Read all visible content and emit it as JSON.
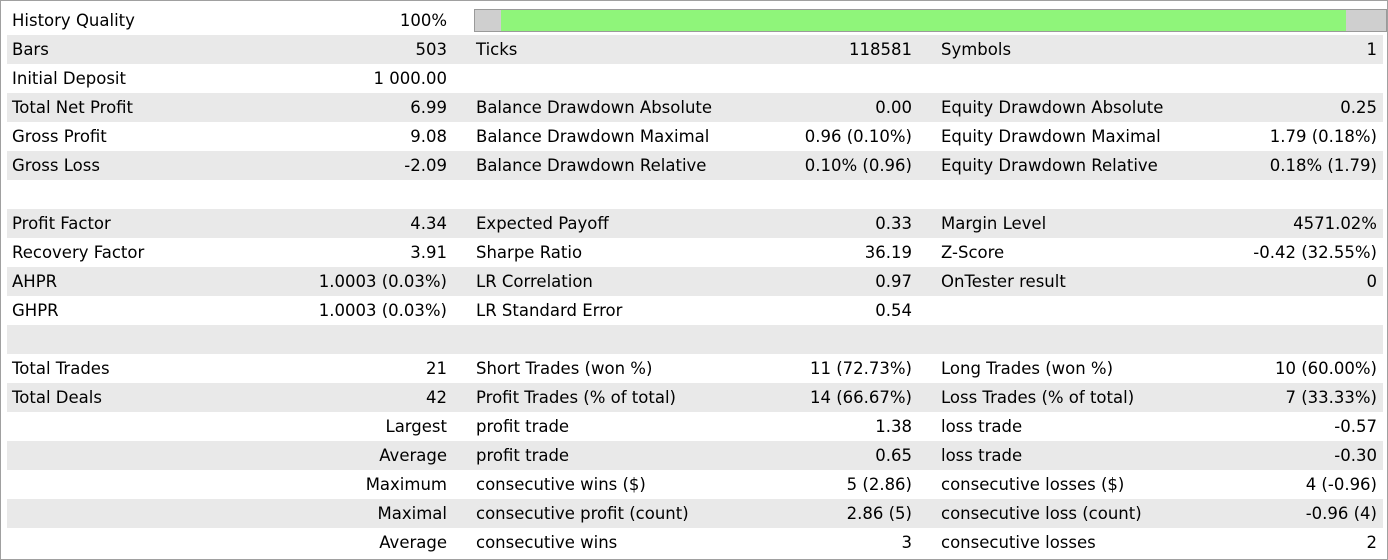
{
  "history_quality": {
    "label": "History Quality",
    "value": "100%",
    "fill_fraction": 0.93
  },
  "rows": [
    {
      "cols": [
        {
          "label": "Bars",
          "value": "503"
        },
        {
          "label": "Ticks",
          "value": "118581"
        },
        {
          "label": "Symbols",
          "value": "1"
        }
      ]
    },
    {
      "cols": [
        {
          "label": "Initial Deposit",
          "value": "1 000.00"
        },
        {
          "label": "",
          "value": ""
        },
        {
          "label": "",
          "value": ""
        }
      ]
    },
    {
      "cols": [
        {
          "label": "Total Net Profit",
          "value": "6.99"
        },
        {
          "label": "Balance Drawdown Absolute",
          "value": "0.00"
        },
        {
          "label": "Equity Drawdown Absolute",
          "value": "0.25"
        }
      ]
    },
    {
      "cols": [
        {
          "label": "Gross Profit",
          "value": "9.08"
        },
        {
          "label": "Balance Drawdown Maximal",
          "value": "0.96 (0.10%)"
        },
        {
          "label": "Equity Drawdown Maximal",
          "value": "1.79 (0.18%)"
        }
      ]
    },
    {
      "cols": [
        {
          "label": "Gross Loss",
          "value": "-2.09"
        },
        {
          "label": "Balance Drawdown Relative",
          "value": "0.10% (0.96)"
        },
        {
          "label": "Equity Drawdown Relative",
          "value": "0.18% (1.79)"
        }
      ]
    },
    {
      "cols": [
        {
          "label": "",
          "value": ""
        },
        {
          "label": "",
          "value": ""
        },
        {
          "label": "",
          "value": ""
        }
      ]
    },
    {
      "cols": [
        {
          "label": "Profit Factor",
          "value": "4.34"
        },
        {
          "label": "Expected Payoff",
          "value": "0.33"
        },
        {
          "label": "Margin Level",
          "value": "4571.02%"
        }
      ]
    },
    {
      "cols": [
        {
          "label": "Recovery Factor",
          "value": "3.91"
        },
        {
          "label": "Sharpe Ratio",
          "value": "36.19"
        },
        {
          "label": "Z-Score",
          "value": "-0.42 (32.55%)"
        }
      ]
    },
    {
      "cols": [
        {
          "label": "AHPR",
          "value": "1.0003 (0.03%)"
        },
        {
          "label": "LR Correlation",
          "value": "0.97"
        },
        {
          "label": "OnTester result",
          "value": "0"
        }
      ]
    },
    {
      "cols": [
        {
          "label": "GHPR",
          "value": "1.0003 (0.03%)"
        },
        {
          "label": "LR Standard Error",
          "value": "0.54"
        },
        {
          "label": "",
          "value": ""
        }
      ]
    },
    {
      "cols": [
        {
          "label": "",
          "value": ""
        },
        {
          "label": "",
          "value": ""
        },
        {
          "label": "",
          "value": ""
        }
      ]
    },
    {
      "cols": [
        {
          "label": "Total Trades",
          "value": "21"
        },
        {
          "label": "Short Trades (won %)",
          "value": "11 (72.73%)"
        },
        {
          "label": "Long Trades (won %)",
          "value": "10 (60.00%)"
        }
      ]
    },
    {
      "cols": [
        {
          "label": "Total Deals",
          "value": "42"
        },
        {
          "label": "Profit Trades (% of total)",
          "value": "14 (66.67%)"
        },
        {
          "label": "Loss Trades (% of total)",
          "value": "7 (33.33%)"
        }
      ]
    },
    {
      "cols": [
        {
          "label": "",
          "value": "Largest"
        },
        {
          "label": "profit trade",
          "value": "1.38"
        },
        {
          "label": "loss trade",
          "value": "-0.57"
        }
      ]
    },
    {
      "cols": [
        {
          "label": "",
          "value": "Average"
        },
        {
          "label": "profit trade",
          "value": "0.65"
        },
        {
          "label": "loss trade",
          "value": "-0.30"
        }
      ]
    },
    {
      "cols": [
        {
          "label": "",
          "value": "Maximum"
        },
        {
          "label": "consecutive wins ($)",
          "value": "5 (2.86)"
        },
        {
          "label": "consecutive losses ($)",
          "value": "4 (-0.96)"
        }
      ]
    },
    {
      "cols": [
        {
          "label": "",
          "value": "Maximal"
        },
        {
          "label": "consecutive profit (count)",
          "value": "2.86 (5)"
        },
        {
          "label": "consecutive loss (count)",
          "value": "-0.96 (4)"
        }
      ]
    },
    {
      "cols": [
        {
          "label": "",
          "value": "Average"
        },
        {
          "label": "consecutive wins",
          "value": "3"
        },
        {
          "label": "consecutive losses",
          "value": "2"
        }
      ]
    }
  ]
}
